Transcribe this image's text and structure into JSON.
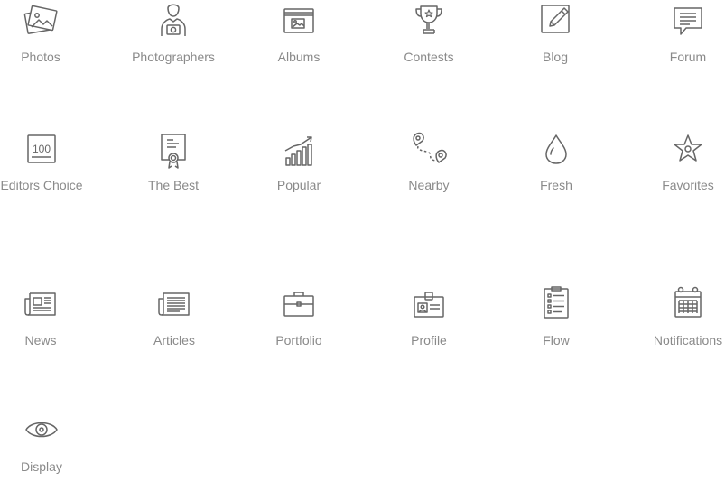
{
  "theme": {
    "icon_color": "#666666",
    "label_color": "#8a8a8a"
  },
  "items": [
    {
      "label": "Photos",
      "icon": "photos-icon"
    },
    {
      "label": "Photographers",
      "icon": "photographer-icon"
    },
    {
      "label": "Albums",
      "icon": "album-icon"
    },
    {
      "label": "Contests",
      "icon": "trophy-icon"
    },
    {
      "label": "Blog",
      "icon": "blog-pencil-icon"
    },
    {
      "label": "Forum",
      "icon": "forum-chat-icon"
    },
    {
      "label": "Editors Choice",
      "icon": "editors-choice-100-icon"
    },
    {
      "label": "The Best",
      "icon": "award-certificate-icon"
    },
    {
      "label": "Popular",
      "icon": "popular-chart-icon"
    },
    {
      "label": "Nearby",
      "icon": "nearby-map-pin-icon"
    },
    {
      "label": "Fresh",
      "icon": "fresh-drop-icon"
    },
    {
      "label": "Favorites",
      "icon": "star-icon"
    },
    {
      "label": "News",
      "icon": "newspaper-icon"
    },
    {
      "label": "Articles",
      "icon": "articles-icon"
    },
    {
      "label": "Portfolio",
      "icon": "briefcase-icon"
    },
    {
      "label": "Profile",
      "icon": "id-badge-icon"
    },
    {
      "label": "Flow",
      "icon": "clipboard-checklist-icon"
    },
    {
      "label": "Notifications",
      "icon": "calendar-icon"
    },
    {
      "label": "Display",
      "icon": "eye-icon"
    }
  ]
}
